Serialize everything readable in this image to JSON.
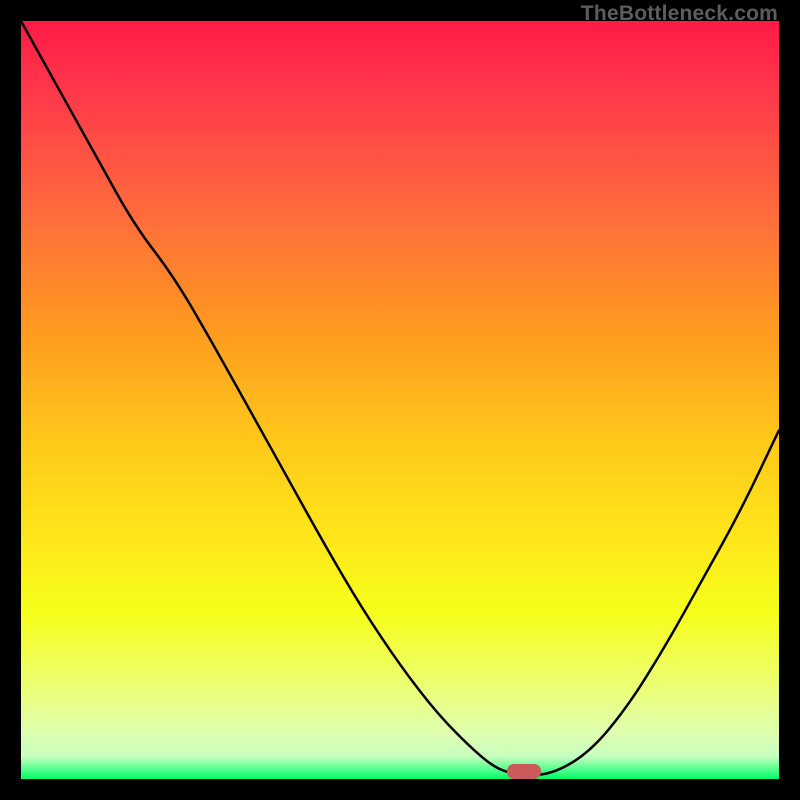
{
  "watermark": "TheBottleneck.com",
  "marker": {
    "x_frac": 0.663,
    "y_frac": 0.995
  },
  "chart_data": {
    "type": "line",
    "title": "",
    "xlabel": "",
    "ylabel": "",
    "xlim": [
      0,
      1
    ],
    "ylim": [
      0,
      1
    ],
    "x": [
      0.0,
      0.05,
      0.1,
      0.15,
      0.2,
      0.25,
      0.3,
      0.35,
      0.4,
      0.45,
      0.5,
      0.55,
      0.6,
      0.63,
      0.66,
      0.7,
      0.75,
      0.8,
      0.85,
      0.9,
      0.95,
      1.0
    ],
    "values": [
      1.0,
      0.91,
      0.82,
      0.73,
      0.665,
      0.58,
      0.49,
      0.4,
      0.31,
      0.225,
      0.15,
      0.085,
      0.035,
      0.012,
      0.005,
      0.006,
      0.035,
      0.095,
      0.175,
      0.265,
      0.355,
      0.46
    ],
    "minimum_marker_x": 0.663,
    "gradient_stops": [
      {
        "pos": 0.0,
        "color": "#ff1a47"
      },
      {
        "pos": 0.5,
        "color": "#ffc71a"
      },
      {
        "pos": 0.8,
        "color": "#f5ff1a"
      },
      {
        "pos": 1.0,
        "color": "#00ff6a"
      }
    ]
  }
}
